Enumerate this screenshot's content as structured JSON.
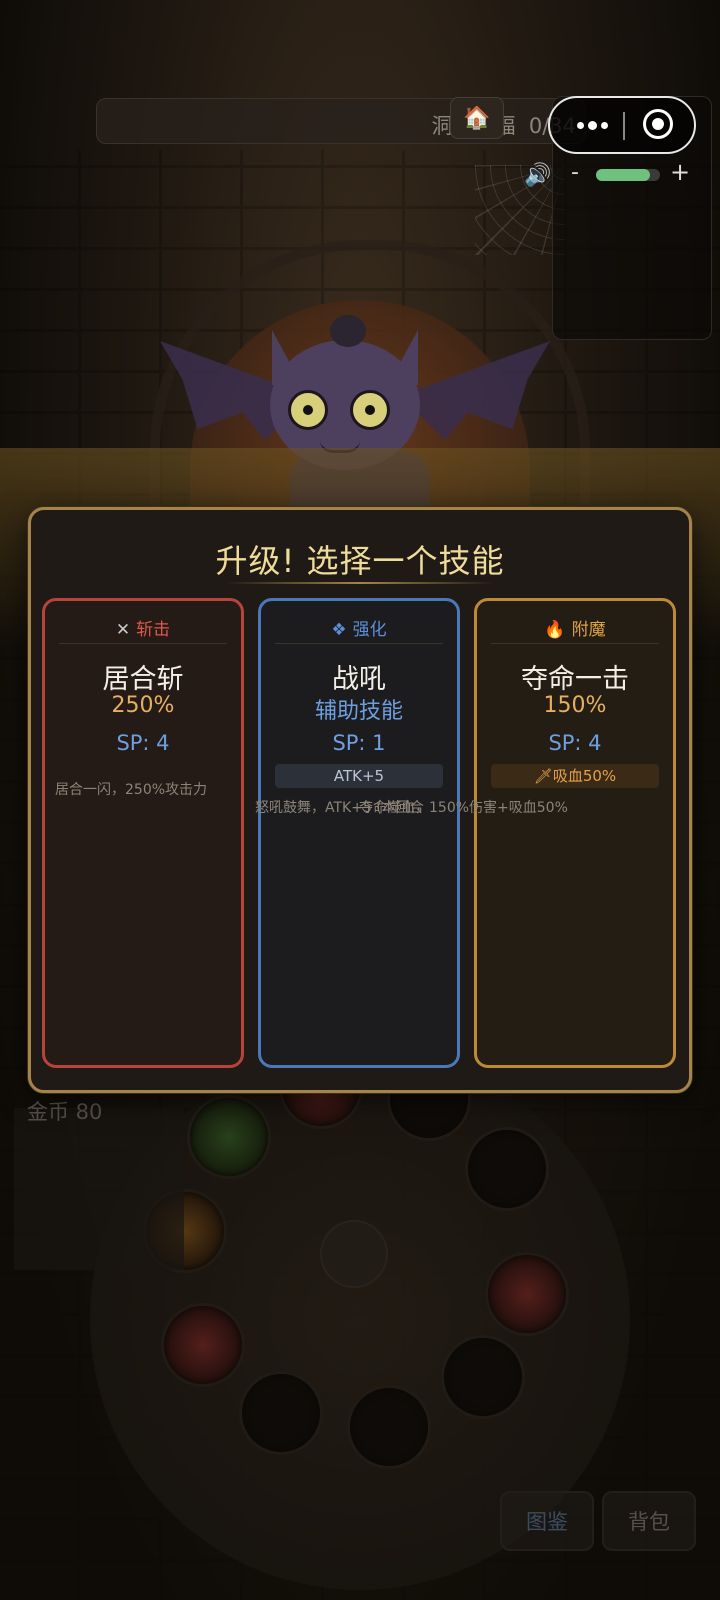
{
  "hud": {
    "enemy_name": "洞穴蝙蝠",
    "kill_progress": "0/34",
    "home_icon": "home-icon",
    "volume_minus": "-",
    "volume_plus": "+",
    "volume_level": 0.85
  },
  "level_up": {
    "title": "升级! 选择一个技能",
    "cards": [
      {
        "category_icon": "✕",
        "category": "斩击",
        "name": "居合斩",
        "subtitle": "250%",
        "sp": "SP: 4",
        "tag": "",
        "description": "居合一闪，250%攻击力"
      },
      {
        "category_icon": "❖",
        "category": "强化",
        "name": "战吼",
        "subtitle": "辅助技能",
        "sp": "SP: 1",
        "tag": "ATK+5",
        "description": "怒吼鼓舞，ATK+5 (本回合"
      },
      {
        "category_icon": "🔥",
        "category": "附魔",
        "name": "夺命一击",
        "subtitle": "150%",
        "sp": "SP: 4",
        "tag": "🗡吸血50%",
        "description": "夺命噬血，150%伤害+吸血50%"
      }
    ]
  },
  "footer": {
    "gold": "金币 80",
    "codex_button": "图鉴",
    "bag_button": "背包"
  },
  "colors": {
    "slash": "#e0574c",
    "buff": "#5d8fd8",
    "enchant": "#e0a445",
    "gold_text": "#e6b060"
  }
}
